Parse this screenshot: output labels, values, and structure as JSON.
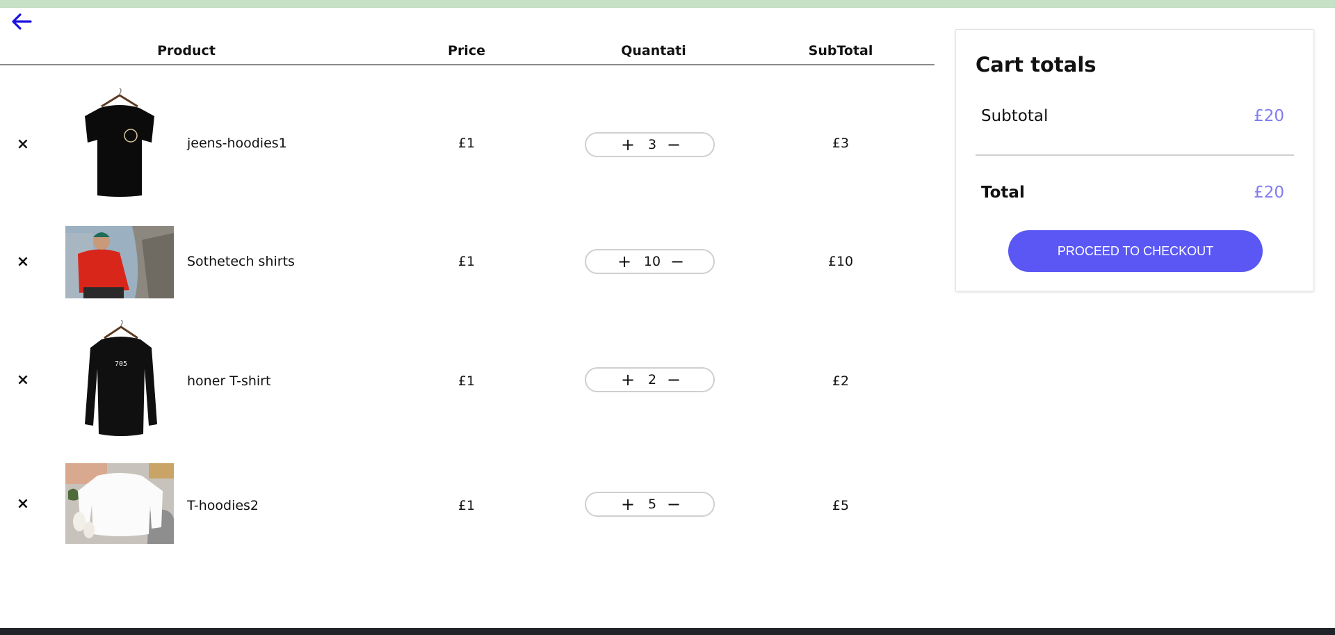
{
  "colors": {
    "accent": "#5a57f4",
    "price_accent": "#7f7cf1",
    "top_strip": "#c6e2c6",
    "back_arrow": "#1a12e0"
  },
  "icons": {
    "back": "arrow-left-icon",
    "remove": "close-x-icon",
    "increase": "plus-icon",
    "decrease": "minus-icon"
  },
  "table": {
    "headers": {
      "product": "Product",
      "price": "Price",
      "quantity": "Quantati",
      "subtotal": "SubTotal"
    },
    "rows": [
      {
        "name": "jeens-hoodies1",
        "price": "£1",
        "quantity": "3",
        "subtotal": "£3",
        "image": "black-tshirt-on-hanger"
      },
      {
        "name": "Sothetech shirts",
        "price": "£1",
        "quantity": "10",
        "subtotal": "£10",
        "image": "man-in-red-jacket-outdoors"
      },
      {
        "name": "honer T-shirt",
        "price": "£1",
        "quantity": "2",
        "subtotal": "£2",
        "image": "black-longsleeve-705"
      },
      {
        "name": "T-hoodies2",
        "price": "£1",
        "quantity": "5",
        "subtotal": "£5",
        "image": "white-sweatshirt-flatlay"
      }
    ],
    "remove_symbol": "×",
    "plus_symbol": "+",
    "minus_symbol": "−"
  },
  "totals": {
    "title": "Cart totals",
    "subtotal_label": "Subtotal",
    "subtotal_value": "£20",
    "total_label": "Total",
    "total_value": "£20",
    "checkout_label": "PROCEED TO CHECKOUT"
  }
}
